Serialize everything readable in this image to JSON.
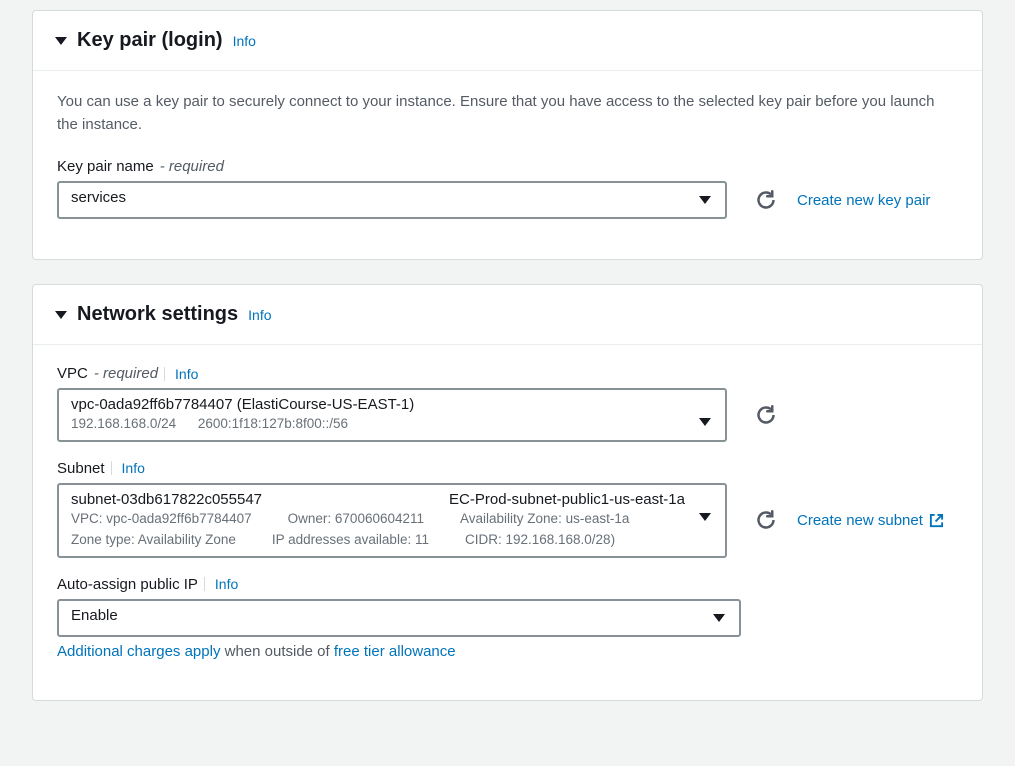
{
  "keypair": {
    "title": "Key pair (login)",
    "info": "Info",
    "help": "You can use a key pair to securely connect to your instance. Ensure that you have access to the selected key pair before you launch the instance.",
    "label": "Key pair name",
    "required": "- required",
    "value": "services",
    "create": "Create new key pair"
  },
  "network": {
    "title": "Network settings",
    "info": "Info",
    "vpc": {
      "label": "VPC",
      "required": "- required",
      "info": "Info",
      "value": "vpc-0ada92ff6b7784407 (ElastiCourse-US-EAST-1)",
      "cidr4": "192.168.168.0/24",
      "cidr6": "2600:1f18:127b:8f00::/56"
    },
    "subnet": {
      "label": "Subnet",
      "info": "Info",
      "id": "subnet-03db617822c055547",
      "name": "EC-Prod-subnet-public1-us-east-1a",
      "vpc": "VPC: vpc-0ada92ff6b7784407",
      "owner": "Owner: 670060604211",
      "az": "Availability Zone: us-east-1a",
      "zonetype": "Zone type: Availability Zone",
      "ips": "IP addresses available: 11",
      "cidr": "CIDR: 192.168.168.0/28)",
      "create": "Create new subnet"
    },
    "autoip": {
      "label": "Auto-assign public IP",
      "info": "Info",
      "value": "Enable",
      "note_link1": "Additional charges apply",
      "note_mid": " when outside of ",
      "note_link2": "free tier allowance"
    }
  }
}
